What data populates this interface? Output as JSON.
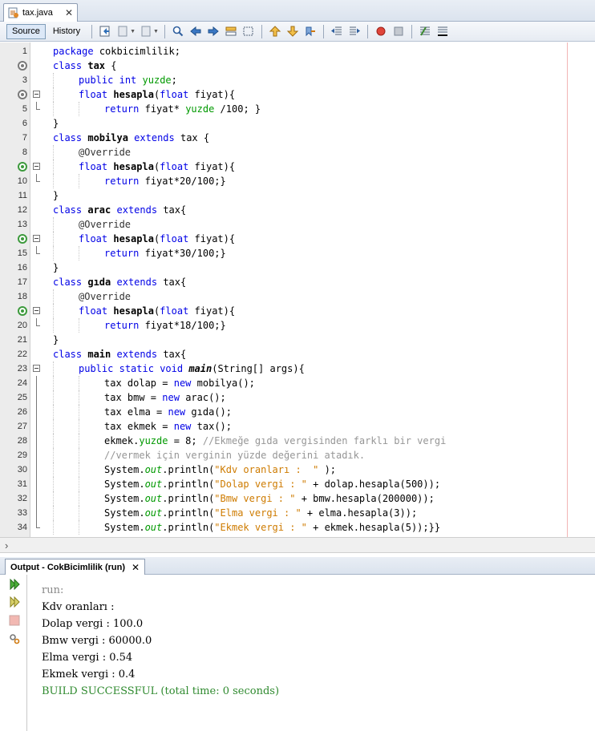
{
  "tab": {
    "title": "tax.java",
    "close": "✕"
  },
  "toolbar": {
    "source": "Source",
    "history": "History"
  },
  "code": [
    {
      "n": "1",
      "mark": "",
      "fold": "",
      "indent": 0,
      "tokens": [
        [
          "k",
          "package"
        ],
        [
          "",
          "cokbicimlilik;"
        ]
      ]
    },
    {
      "n": "2",
      "mark": "o",
      "fold": "",
      "indent": 0,
      "tokens": [
        [
          "k",
          "class"
        ],
        [
          "b",
          "tax"
        ],
        [
          "",
          "{"
        ]
      ]
    },
    {
      "n": "3",
      "mark": "",
      "fold": "",
      "indent": 1,
      "tokens": [
        [
          "k",
          "public"
        ],
        [
          "k",
          "int"
        ],
        [
          "f",
          "yuzde"
        ],
        [
          "",
          ";"
        ]
      ]
    },
    {
      "n": "4",
      "mark": "o",
      "fold": "open",
      "indent": 1,
      "tokens": [
        [
          "k",
          "float"
        ],
        [
          "b",
          "hesapla"
        ],
        [
          "",
          "("
        ],
        [
          "k",
          "float"
        ],
        [
          "",
          "fiyat){"
        ]
      ]
    },
    {
      "n": "5",
      "mark": "",
      "fold": "end",
      "indent": 2,
      "tokens": [
        [
          "k",
          "return"
        ],
        [
          "",
          "fiyat*"
        ],
        [
          "f",
          "yuzde"
        ],
        [
          "",
          "/100; }"
        ]
      ]
    },
    {
      "n": "6",
      "mark": "",
      "fold": "",
      "indent": 0,
      "tokens": [
        [
          "",
          "}"
        ]
      ]
    },
    {
      "n": "7",
      "mark": "",
      "fold": "",
      "indent": 0,
      "tokens": [
        [
          "k",
          "class"
        ],
        [
          "b",
          "mobilya"
        ],
        [
          "k",
          "extends"
        ],
        [
          "",
          "tax {"
        ]
      ]
    },
    {
      "n": "8",
      "mark": "",
      "fold": "",
      "indent": 1,
      "tokens": [
        [
          "an",
          "@Override"
        ]
      ]
    },
    {
      "n": "9",
      "mark": "g",
      "fold": "open",
      "indent": 1,
      "tokens": [
        [
          "k",
          "float"
        ],
        [
          "b",
          "hesapla"
        ],
        [
          "",
          "("
        ],
        [
          "k",
          "float"
        ],
        [
          "",
          "fiyat){"
        ]
      ]
    },
    {
      "n": "10",
      "mark": "",
      "fold": "end",
      "indent": 2,
      "tokens": [
        [
          "k",
          "return"
        ],
        [
          "",
          "fiyat*20/100;}"
        ]
      ]
    },
    {
      "n": "11",
      "mark": "",
      "fold": "",
      "indent": 0,
      "tokens": [
        [
          "",
          "}"
        ]
      ]
    },
    {
      "n": "12",
      "mark": "",
      "fold": "",
      "indent": 0,
      "tokens": [
        [
          "k",
          "class"
        ],
        [
          "b",
          "arac"
        ],
        [
          "k",
          "extends"
        ],
        [
          "",
          "tax{"
        ]
      ]
    },
    {
      "n": "13",
      "mark": "",
      "fold": "",
      "indent": 1,
      "tokens": [
        [
          "an",
          "@Override"
        ]
      ]
    },
    {
      "n": "14",
      "mark": "g",
      "fold": "open",
      "indent": 1,
      "tokens": [
        [
          "k",
          "float"
        ],
        [
          "b",
          "hesapla"
        ],
        [
          "",
          "("
        ],
        [
          "k",
          "float"
        ],
        [
          "",
          "fiyat){"
        ]
      ]
    },
    {
      "n": "15",
      "mark": "",
      "fold": "end",
      "indent": 2,
      "tokens": [
        [
          "k",
          "return"
        ],
        [
          "",
          "fiyat*30/100;}"
        ]
      ]
    },
    {
      "n": "16",
      "mark": "",
      "fold": "",
      "indent": 0,
      "tokens": [
        [
          "",
          "}"
        ]
      ]
    },
    {
      "n": "17",
      "mark": "",
      "fold": "",
      "indent": 0,
      "tokens": [
        [
          "k",
          "class"
        ],
        [
          "b",
          "gıda"
        ],
        [
          "k",
          "extends"
        ],
        [
          "",
          "tax{"
        ]
      ]
    },
    {
      "n": "18",
      "mark": "",
      "fold": "",
      "indent": 1,
      "tokens": [
        [
          "an",
          "@Override"
        ]
      ]
    },
    {
      "n": "19",
      "mark": "g",
      "fold": "open",
      "indent": 1,
      "tokens": [
        [
          "k",
          "float"
        ],
        [
          "b",
          "hesapla"
        ],
        [
          "",
          "("
        ],
        [
          "k",
          "float"
        ],
        [
          "",
          "fiyat){"
        ]
      ]
    },
    {
      "n": "20",
      "mark": "",
      "fold": "end",
      "indent": 2,
      "tokens": [
        [
          "k",
          "return"
        ],
        [
          "",
          "fiyat*18/100;}"
        ]
      ]
    },
    {
      "n": "21",
      "mark": "",
      "fold": "",
      "indent": 0,
      "tokens": [
        [
          "",
          "}"
        ]
      ]
    },
    {
      "n": "22",
      "mark": "",
      "fold": "",
      "indent": 0,
      "tokens": [
        [
          "k",
          "class"
        ],
        [
          "b",
          "main"
        ],
        [
          "k",
          "extends"
        ],
        [
          "",
          "tax{"
        ]
      ]
    },
    {
      "n": "23",
      "mark": "",
      "fold": "open",
      "indent": 1,
      "tokens": [
        [
          "k",
          "public"
        ],
        [
          "k",
          "static"
        ],
        [
          "k",
          "void"
        ],
        [
          "bi",
          "main"
        ],
        [
          "",
          "(String[] args){"
        ]
      ]
    },
    {
      "n": "24",
      "mark": "",
      "fold": "line",
      "indent": 2,
      "tokens": [
        [
          "",
          "tax dolap ="
        ],
        [
          "k",
          "new"
        ],
        [
          "",
          "mobilya();"
        ]
      ]
    },
    {
      "n": "25",
      "mark": "",
      "fold": "line",
      "indent": 2,
      "tokens": [
        [
          "",
          "tax bmw ="
        ],
        [
          "k",
          "new"
        ],
        [
          "",
          "arac();"
        ]
      ]
    },
    {
      "n": "26",
      "mark": "",
      "fold": "line",
      "indent": 2,
      "tokens": [
        [
          "",
          "tax elma ="
        ],
        [
          "k",
          "new"
        ],
        [
          "",
          "gıda();"
        ]
      ]
    },
    {
      "n": "27",
      "mark": "",
      "fold": "line",
      "indent": 2,
      "tokens": [
        [
          "",
          "tax ekmek ="
        ],
        [
          "k",
          "new"
        ],
        [
          "",
          "tax();"
        ]
      ]
    },
    {
      "n": "28",
      "mark": "",
      "fold": "line",
      "indent": 2,
      "tokens": [
        [
          "",
          "ekmek."
        ],
        [
          "f",
          "yuzde"
        ],
        [
          "",
          "= 8;"
        ],
        [
          "cm",
          "//Ekmeğe gıda vergisinden farklı bir vergi"
        ]
      ]
    },
    {
      "n": "29",
      "mark": "",
      "fold": "line",
      "indent": 2,
      "tokens": [
        [
          "cm",
          "//vermek için verginin yüzde değerini atadık."
        ]
      ]
    },
    {
      "n": "30",
      "mark": "",
      "fold": "line",
      "indent": 2,
      "tokens": [
        [
          "",
          "System."
        ],
        [
          "o",
          "out"
        ],
        [
          "",
          ".println("
        ],
        [
          "s",
          "\"Kdv oranları :  \""
        ],
        [
          "",
          ");"
        ]
      ]
    },
    {
      "n": "31",
      "mark": "",
      "fold": "line",
      "indent": 2,
      "tokens": [
        [
          "",
          "System."
        ],
        [
          "o",
          "out"
        ],
        [
          "",
          ".println("
        ],
        [
          "s",
          "\"Dolap vergi : \""
        ],
        [
          "",
          "+ dolap.hesapla(500));"
        ]
      ]
    },
    {
      "n": "32",
      "mark": "",
      "fold": "line",
      "indent": 2,
      "tokens": [
        [
          "",
          "System."
        ],
        [
          "o",
          "out"
        ],
        [
          "",
          ".println("
        ],
        [
          "s",
          "\"Bmw vergi : \""
        ],
        [
          "",
          "+ bmw.hesapla(200000));"
        ]
      ]
    },
    {
      "n": "33",
      "mark": "",
      "fold": "line",
      "indent": 2,
      "tokens": [
        [
          "",
          "System."
        ],
        [
          "o",
          "out"
        ],
        [
          "",
          ".println("
        ],
        [
          "s",
          "\"Elma vergi : \""
        ],
        [
          "",
          "+ elma.hesapla(3));"
        ]
      ]
    },
    {
      "n": "34",
      "mark": "",
      "fold": "end",
      "indent": 2,
      "tokens": [
        [
          "",
          "System."
        ],
        [
          "o",
          "out"
        ],
        [
          "",
          ".println("
        ],
        [
          "s",
          "\"Ekmek vergi : \""
        ],
        [
          "",
          "+ ekmek.hesapla(5));}}"
        ]
      ]
    }
  ],
  "output": {
    "title": "Output - CokBicimlilik (run)",
    "close": "✕",
    "lines": [
      {
        "cls": "run",
        "text": "run:"
      },
      {
        "cls": "",
        "text": "Kdv oranları :"
      },
      {
        "cls": "",
        "text": "Dolap vergi : 100.0"
      },
      {
        "cls": "",
        "text": "Bmw vergi : 60000.0"
      },
      {
        "cls": "",
        "text": "Elma vergi : 0.54"
      },
      {
        "cls": "",
        "text": "Ekmek vergi : 0.4"
      },
      {
        "cls": "ok",
        "text": "BUILD SUCCESSFUL (total time: 0 seconds)"
      }
    ]
  },
  "colors": {
    "keyword": "#0000e6",
    "field": "#009900",
    "string": "#ce7b00",
    "comment": "#969696"
  }
}
